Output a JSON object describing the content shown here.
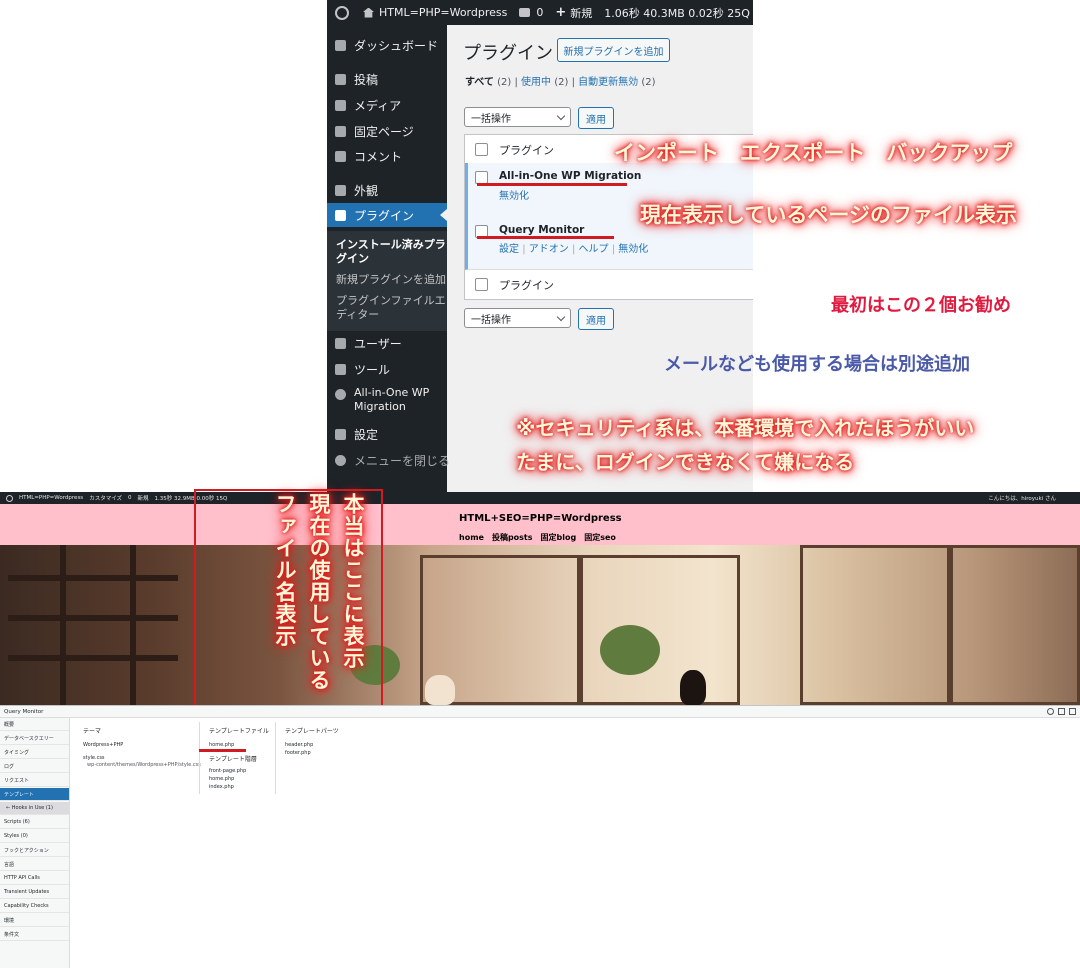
{
  "admin_bar": {
    "site": "HTML=PHP=Wordpress",
    "comments": "0",
    "new": "新規",
    "stats": "1.06秒  40.3MB  0.02秒  25Q"
  },
  "side_menu": {
    "items": [
      "ダッシュボード",
      "投稿",
      "メディア",
      "固定ページ",
      "コメント",
      "外観",
      "プラグイン"
    ],
    "sub_items": [
      "インストール済みプラグイン",
      "新規プラグインを追加",
      "プラグインファイルエディター"
    ],
    "items_after": [
      "ユーザー",
      "ツール",
      "All-in-One WP Migration",
      "設定",
      "メニューを閉じる"
    ]
  },
  "plugins_page": {
    "title": "プラグイン",
    "add_new": "新規プラグインを追加",
    "filter_all": "すべて",
    "filter_all_count": "(2)",
    "filter_active": "使用中",
    "filter_active_count": "(2)",
    "filter_auto": "自動更新無効",
    "filter_auto_count": "(2)",
    "bulk_action": "一括操作",
    "apply": "適用",
    "column_header": "プラグイン",
    "plugins": [
      {
        "name": "All-in-One WP Migration",
        "links": [
          "無効化"
        ]
      },
      {
        "name": "Query Monitor",
        "links": [
          "設定",
          "アドオン",
          "ヘルプ",
          "無効化"
        ]
      }
    ],
    "separator": "|"
  },
  "annotations": {
    "import_export": "インポート　エクスポート　バックアップ",
    "file_display": "現在表示しているページのファイル表示",
    "recommend": "最初はこの２個お勧め",
    "mail": "メールなども使用する場合は別途追加",
    "security1": "※セキュリティ系は、本番環境で入れたほうがいい",
    "security2": "たまに、ログインできなくて嫌になる",
    "vertical1": "本当はここに表示",
    "vertical2": "現在の使用している",
    "vertical3": "ファイル名表示"
  },
  "front_bar": {
    "site": "HTML=PHP=Wordpress",
    "customize": "カスタマイズ",
    "comments": "0",
    "new": "新規",
    "stats": "1.35秒 32.9MB 0.00秒 15Q",
    "greeting": "こんにちは、hiroyuki さん"
  },
  "front_site": {
    "title": "HTML+SEO=PHP=Wordpress",
    "nav": "home　投稿posts　固定blog　固定seo"
  },
  "query_monitor": {
    "title": "Query Monitor",
    "menu": [
      "概要",
      "データベースクエリー",
      "タイミング",
      "ログ",
      "リクエスト",
      "テンプレート",
      "← Hooks in Use (1)",
      "Scripts (6)",
      "Styles (0)",
      "フックとアクション",
      "言語",
      "HTTP API Calls",
      "Transient Updates",
      "Capability Checks",
      "環境",
      "条件文"
    ],
    "theme_head": "テーマ",
    "theme_name": "Wordpress+PHP",
    "style_file": "style.css",
    "style_path": "wp-content/themes/Wordpress+PHP/style.css",
    "template_head": "テンプレートファイル",
    "template_file": "home.php",
    "template_hierarchy_head": "テンプレート階層",
    "hierarchy": [
      "front-page.php",
      "home.php",
      "index.php"
    ],
    "parts_head": "テンプレートパーツ",
    "parts": [
      "header.php",
      "footer.php"
    ]
  }
}
